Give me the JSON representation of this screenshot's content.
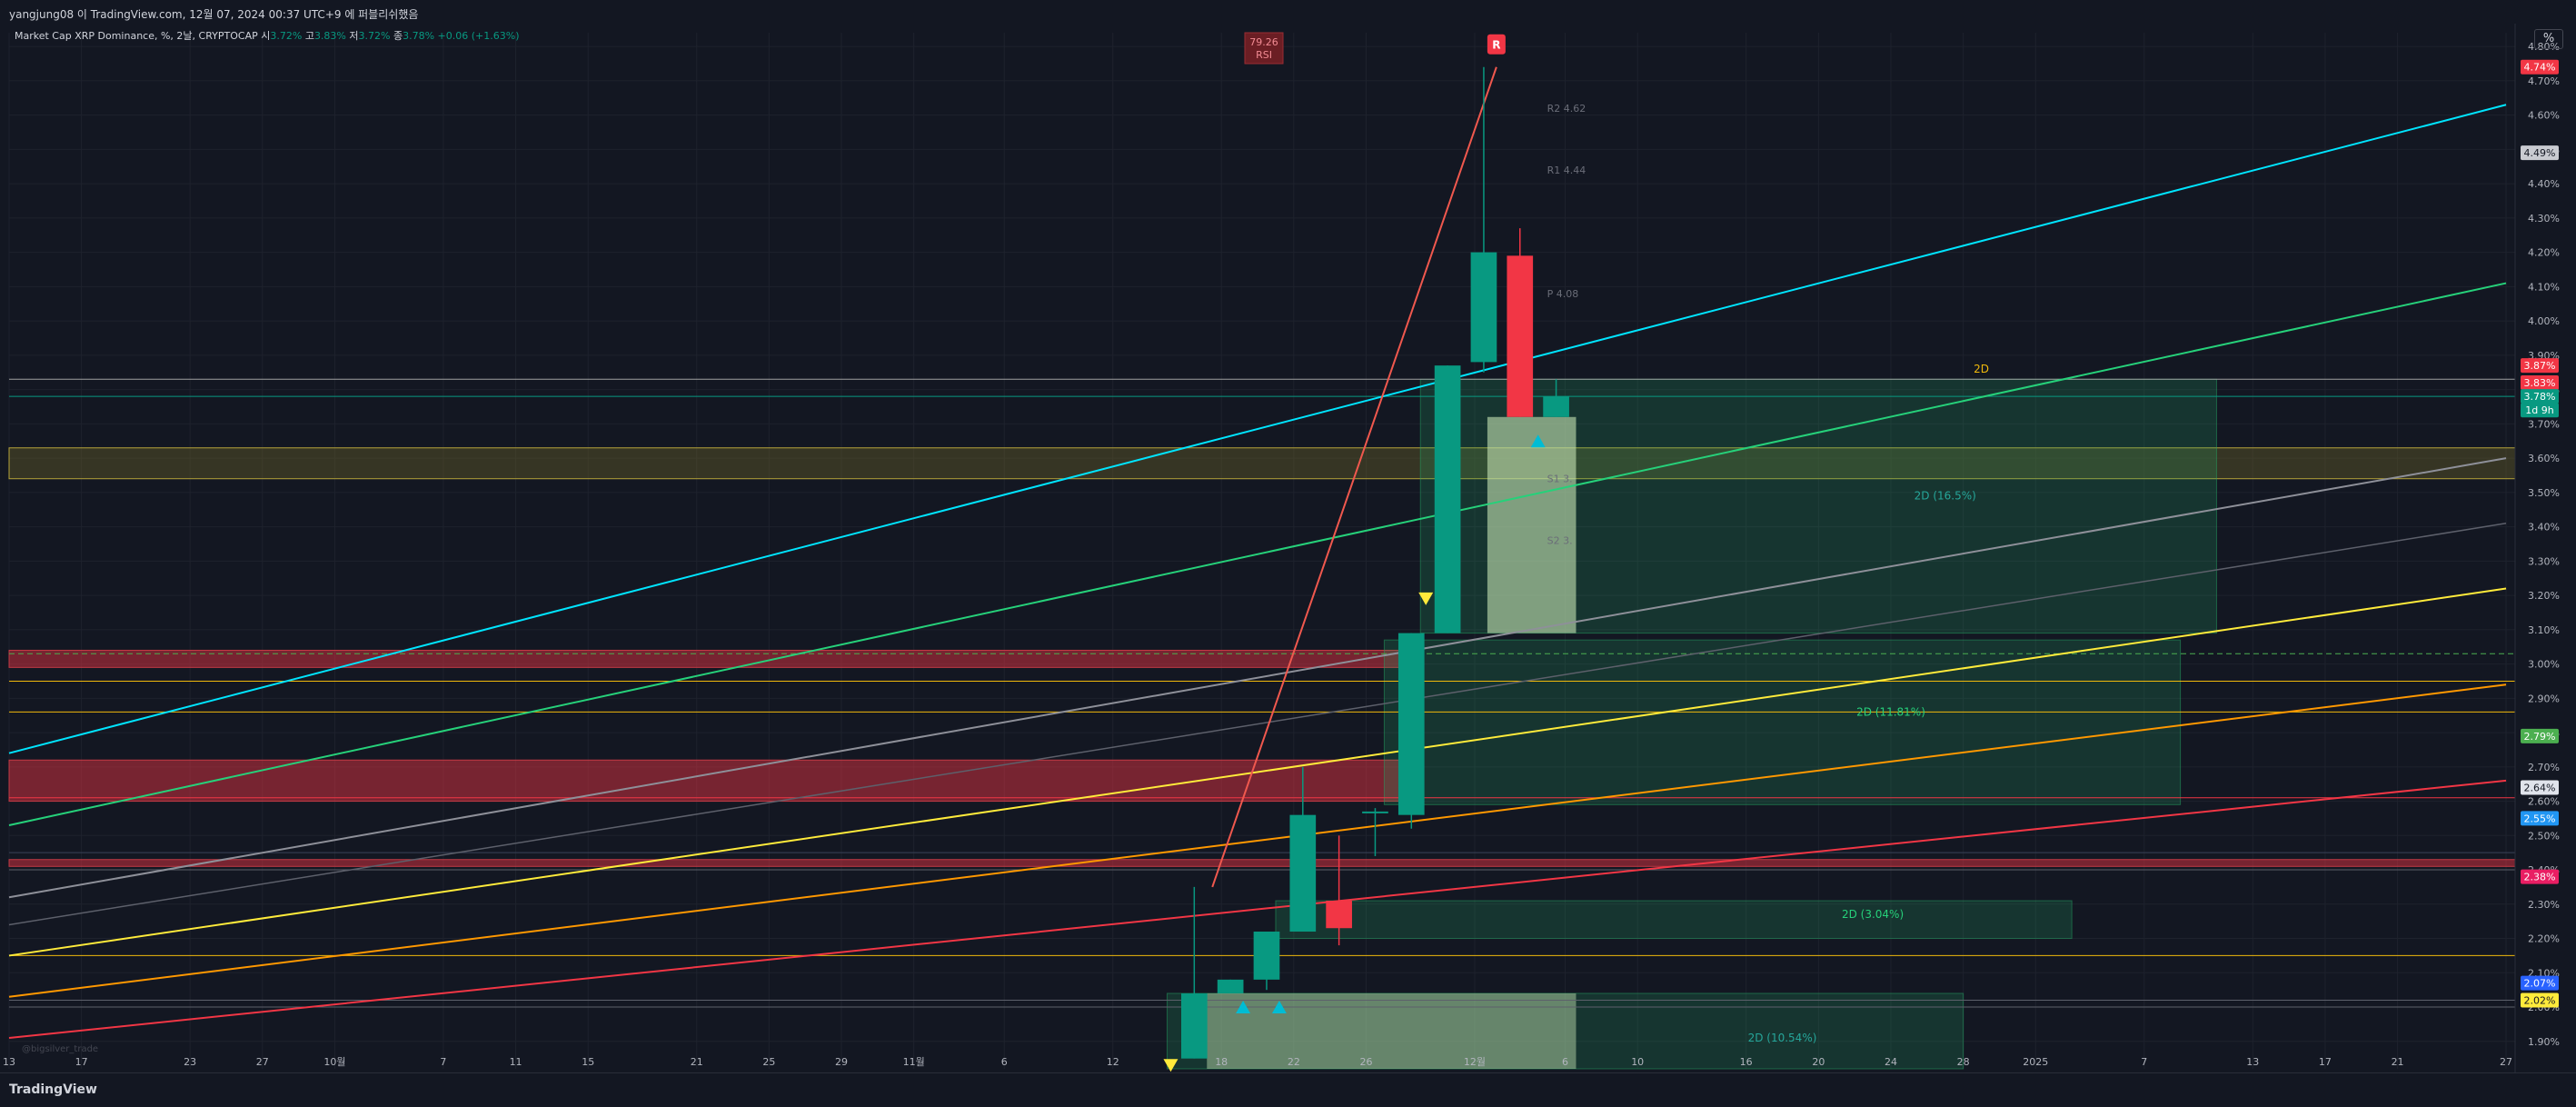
{
  "header": {
    "publish_line": "yangjung08 이 TradingView.com, 12월 07, 2024 00:37 UTC+9 에 퍼블리쉬했음",
    "legend_prefix": "Market Cap XRP Dominance, %, 2날, CRYPTOCAP",
    "ohlc": [
      {
        "label": "시",
        "value": "3.72%"
      },
      {
        "label": "고",
        "value": "3.83%"
      },
      {
        "label": "저",
        "value": "3.72%"
      },
      {
        "label": "종",
        "value": "3.78%"
      }
    ],
    "change": "+0.06 (+1.63%)",
    "rsi_label": "79.26",
    "rsi_sub": "RSI",
    "signal_letter": "R",
    "scale_button": "%"
  },
  "footer": {
    "brand": "TradingView",
    "watermark": "@bigsilver_trade"
  },
  "colors": {
    "background": "#131722",
    "up": "#089981",
    "down": "#f23645",
    "cyan_line": "#00e5ff",
    "green_line": "#26d17a",
    "yellow_line": "#ffeb3b",
    "orange_line": "#ff9800",
    "red_line": "#f23645",
    "blue_line": "#2962ff"
  },
  "chart_data": {
    "type": "candlestick",
    "symbol": "CRYPTOCAP XRP Dominance",
    "timeframe": "2D",
    "ylim": [
      1.82,
      4.84
    ],
    "yticks": [
      "4.80%",
      "4.70%",
      "4.60%",
      "4.50%",
      "4.40%",
      "4.30%",
      "4.20%",
      "4.10%",
      "4.00%",
      "3.90%",
      "3.80%",
      "3.70%",
      "3.60%",
      "3.50%",
      "3.40%",
      "3.30%",
      "3.20%",
      "3.10%",
      "3.00%",
      "2.90%",
      "2.80%",
      "2.70%",
      "2.60%",
      "2.50%",
      "2.40%",
      "2.30%",
      "2.20%",
      "2.10%",
      "2.00%",
      "1.90%"
    ],
    "xlabels": [
      {
        "d": 0,
        "label": "13"
      },
      {
        "d": 4,
        "label": "17"
      },
      {
        "d": 10,
        "label": "23"
      },
      {
        "d": 14,
        "label": "27"
      },
      {
        "d": 18,
        "label": "10월"
      },
      {
        "d": 24,
        "label": "7"
      },
      {
        "d": 28,
        "label": "11"
      },
      {
        "d": 32,
        "label": "15"
      },
      {
        "d": 38,
        "label": "21"
      },
      {
        "d": 42,
        "label": "25"
      },
      {
        "d": 46,
        "label": "29"
      },
      {
        "d": 50,
        "label": "11월"
      },
      {
        "d": 55,
        "label": "6"
      },
      {
        "d": 61,
        "label": "12"
      },
      {
        "d": 67,
        "label": "18"
      },
      {
        "d": 71,
        "label": "22"
      },
      {
        "d": 75,
        "label": "26"
      },
      {
        "d": 81,
        "label": "12월"
      },
      {
        "d": 86,
        "label": "6"
      },
      {
        "d": 90,
        "label": "10"
      },
      {
        "d": 96,
        "label": "16"
      },
      {
        "d": 100,
        "label": "20"
      },
      {
        "d": 104,
        "label": "24"
      },
      {
        "d": 108,
        "label": "28"
      },
      {
        "d": 112,
        "label": "2025"
      },
      {
        "d": 118,
        "label": "7"
      },
      {
        "d": 124,
        "label": "13"
      },
      {
        "d": 128,
        "label": "17"
      },
      {
        "d": 132,
        "label": "21"
      },
      {
        "d": 138,
        "label": "27"
      }
    ],
    "candles": [
      {
        "d": 65.5,
        "o": 1.85,
        "h": 2.35,
        "l": 1.85,
        "c": 2.04
      },
      {
        "d": 67.5,
        "o": 2.04,
        "h": 2.08,
        "l": 2.04,
        "c": 2.08
      },
      {
        "d": 69.5,
        "o": 2.08,
        "h": 2.22,
        "l": 2.05,
        "c": 2.22
      },
      {
        "d": 71.5,
        "o": 2.22,
        "h": 2.7,
        "l": 2.22,
        "c": 2.56
      },
      {
        "d": 73.5,
        "o": 2.31,
        "h": 2.5,
        "l": 2.18,
        "c": 2.23
      },
      {
        "d": 75.5,
        "o": 2.57,
        "h": 2.58,
        "l": 2.44,
        "c": 2.57
      },
      {
        "d": 77.5,
        "o": 2.56,
        "h": 3.09,
        "l": 2.52,
        "c": 3.09
      },
      {
        "d": 79.5,
        "o": 3.09,
        "h": 3.87,
        "l": 3.09,
        "c": 3.87
      },
      {
        "d": 81.5,
        "o": 3.88,
        "h": 4.74,
        "l": 3.85,
        "c": 4.2
      },
      {
        "d": 83.5,
        "o": 4.19,
        "h": 4.27,
        "l": 3.72,
        "c": 3.72
      },
      {
        "d": 85.5,
        "o": 3.72,
        "h": 3.83,
        "l": 3.72,
        "c": 3.78
      }
    ],
    "trendlines": [
      {
        "name": "cyan",
        "color": "#00e5ff",
        "p1": [
          0,
          2.74
        ],
        "p2": [
          138,
          4.63
        ],
        "width": 2
      },
      {
        "name": "green",
        "color": "#26d17a",
        "p1": [
          0,
          2.53
        ],
        "p2": [
          138,
          4.11
        ],
        "width": 2
      },
      {
        "name": "white",
        "color": "#8e9099",
        "p1": [
          0,
          2.32
        ],
        "p2": [
          138,
          3.6
        ],
        "width": 2
      },
      {
        "name": "grey",
        "color": "#5d606b",
        "p1": [
          0,
          2.24
        ],
        "p2": [
          138,
          3.41
        ],
        "width": 1.5
      },
      {
        "name": "yellow",
        "color": "#ffeb3b",
        "p1": [
          0,
          2.15
        ],
        "p2": [
          138,
          3.22
        ],
        "width": 2
      },
      {
        "name": "orange",
        "color": "#ff9800",
        "p1": [
          0,
          2.03
        ],
        "p2": [
          138,
          2.94
        ],
        "width": 2
      },
      {
        "name": "red",
        "color": "#f23645",
        "p1": [
          0,
          1.91
        ],
        "p2": [
          138,
          2.66
        ],
        "width": 2
      },
      {
        "name": "rsi-red",
        "color": "#f0584e",
        "p1": [
          66.5,
          2.35
        ],
        "p2": [
          82.2,
          4.74
        ],
        "width": 2
      }
    ],
    "zones": [
      {
        "kind": "red",
        "from": 2.99,
        "to": 3.04,
        "d0": 0,
        "d1": 77
      },
      {
        "kind": "red",
        "from": 2.6,
        "to": 2.72,
        "d0": 0,
        "d1": 77
      },
      {
        "kind": "red",
        "from": 2.41,
        "to": 2.43,
        "d0": 0,
        "d1": 138
      },
      {
        "kind": "olive",
        "from": 3.54,
        "to": 3.63,
        "d0": 0,
        "d1": 138
      },
      {
        "kind": "green",
        "from": 3.09,
        "to": 3.83,
        "d0": 78,
        "d1": 122
      },
      {
        "kind": "green",
        "from": 2.59,
        "to": 3.07,
        "d0": 76,
        "d1": 120
      },
      {
        "kind": "green",
        "from": 2.2,
        "to": 2.31,
        "d0": 70,
        "d1": 114
      },
      {
        "kind": "green",
        "from": 1.82,
        "to": 2.04,
        "d0": 64,
        "d1": 108
      }
    ],
    "hlines": [
      {
        "y": 3.83,
        "color": "#a0a0a0"
      },
      {
        "y": 3.78,
        "color": "#089981"
      },
      {
        "y": 3.03,
        "color": "#4caf50"
      },
      {
        "y": 2.95,
        "color": "#f0b90b"
      },
      {
        "y": 2.86,
        "color": "#f0b90b"
      },
      {
        "y": 2.61,
        "color": "#f23645"
      },
      {
        "y": 2.45,
        "color": "#3a4257"
      },
      {
        "y": 2.4,
        "color": "#5d606b"
      },
      {
        "y": 2.15,
        "color": "#f0b90b"
      },
      {
        "y": 2.02,
        "color": "#5d606b"
      },
      {
        "y": 2.0,
        "color": "#5d606b"
      }
    ],
    "zone_labels": [
      {
        "text": "2D",
        "d": 109,
        "y": 3.86,
        "color": "#f0b90b"
      },
      {
        "text": "2D (16.5%)",
        "d": 107,
        "y": 3.49,
        "color": "#26a69a"
      },
      {
        "text": "2D (11.81%)",
        "d": 104,
        "y": 2.86,
        "color": "#26d17a"
      },
      {
        "text": "2D (3.04%)",
        "d": 103,
        "y": 2.27,
        "color": "#26d17a"
      },
      {
        "text": "2D (10.54%)",
        "d": 98,
        "y": 1.91,
        "color": "#26a69a"
      }
    ],
    "pivot_labels": [
      {
        "text": "R2 4.62",
        "d": 85,
        "y": 4.62
      },
      {
        "text": "R1 4.44",
        "d": 85,
        "y": 4.44
      },
      {
        "text": "P 4.08",
        "d": 85,
        "y": 4.08
      },
      {
        "text": "S1 3.",
        "d": 85,
        "y": 3.54
      },
      {
        "text": "S2 3.",
        "d": 85,
        "y": 3.36
      }
    ],
    "price_tags": [
      {
        "text": "4.74%",
        "y": 4.74,
        "bg": "#f23645",
        "fg": "#ffffff"
      },
      {
        "text": "4.49%",
        "y": 4.49,
        "bg": "#c9cbd1",
        "fg": "#131722"
      },
      {
        "text": "3.87%",
        "y": 3.87,
        "bg": "#f23645",
        "fg": "#ffffff"
      },
      {
        "text": "3.83%",
        "y": 3.82,
        "bg": "#f23645",
        "fg": "#ffffff"
      },
      {
        "text": "3.78%",
        "y": 3.78,
        "bg": "#089981",
        "fg": "#ffffff"
      },
      {
        "text": "1d 9h",
        "y": 3.74,
        "bg": "#089981",
        "fg": "#ffffff"
      },
      {
        "text": "2.79%",
        "y": 2.79,
        "bg": "#4caf50",
        "fg": "#ffffff"
      },
      {
        "text": "2.64%",
        "y": 2.64,
        "bg": "#e0e3eb",
        "fg": "#131722"
      },
      {
        "text": "2.55%",
        "y": 2.55,
        "bg": "#2196f3",
        "fg": "#ffffff"
      },
      {
        "text": "2.38%",
        "y": 2.38,
        "bg": "#e91e63",
        "fg": "#ffffff"
      },
      {
        "text": "2.07%",
        "y": 2.07,
        "bg": "#2962ff",
        "fg": "#ffffff"
      },
      {
        "text": "2.02%",
        "y": 2.02,
        "bg": "#ffeb3b",
        "fg": "#131722"
      }
    ]
  }
}
